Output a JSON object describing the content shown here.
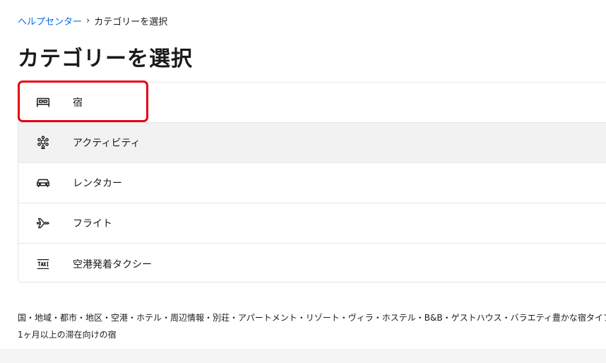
{
  "breadcrumb": {
    "home": "ヘルプセンター",
    "current": "カテゴリーを選択"
  },
  "page_title": "カテゴリーを選択",
  "categories": [
    {
      "label": "宿",
      "icon": "bed-icon"
    },
    {
      "label": "アクティビティ",
      "icon": "attractions-icon"
    },
    {
      "label": "レンタカー",
      "icon": "car-icon"
    },
    {
      "label": "フライト",
      "icon": "airplane-icon"
    },
    {
      "label": "空港発着タクシー",
      "icon": "taxi-icon"
    }
  ],
  "description": {
    "line1": "国・地域・都市・地区・空港・ホテル・周辺情報・別荘・アパートメント・リゾート・ヴィラ・ホステル・B&B・ゲストハウス・バラエティ豊かな宿タイプ",
    "line2": "1ヶ月以上の滞在向けの宿"
  },
  "colors": {
    "link": "#006ce4",
    "highlight": "#e60012",
    "hover_bg": "#f2f2f2"
  }
}
